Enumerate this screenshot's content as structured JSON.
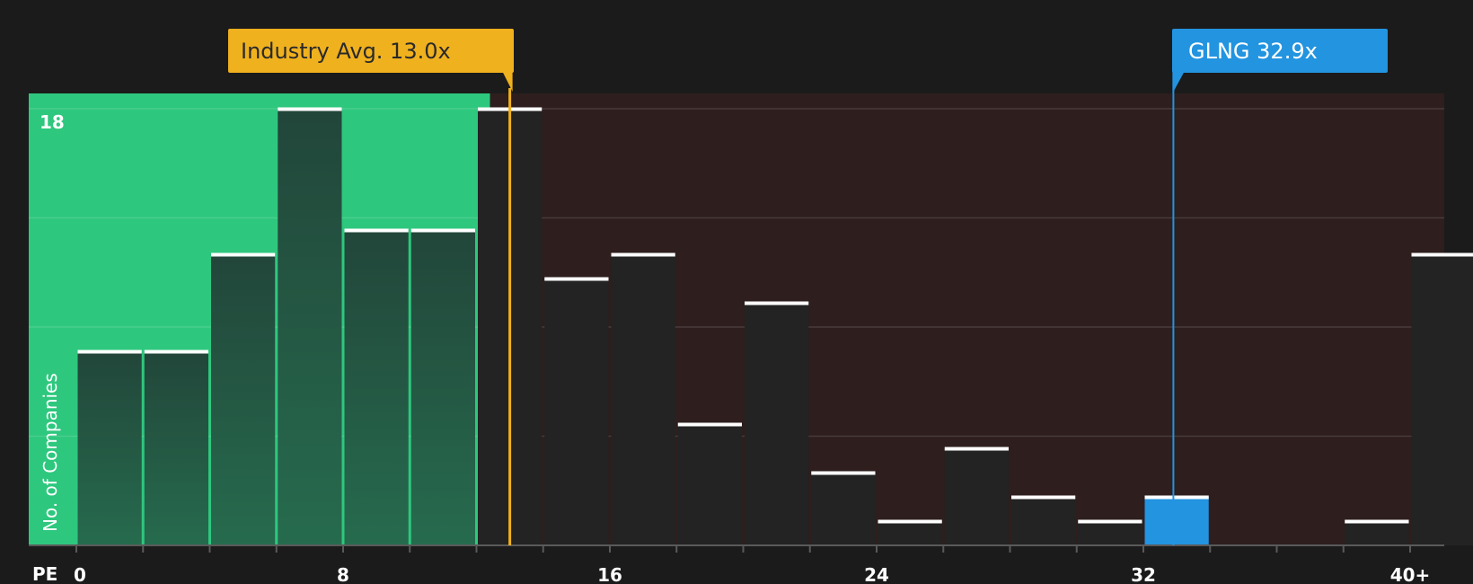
{
  "chart_data": {
    "type": "bar",
    "title": "",
    "xlabel": "PE",
    "ylabel": "No. of Companies",
    "x_ticks": [
      "0",
      "8",
      "16",
      "24",
      "32",
      "40+"
    ],
    "y_tick_labeled": "18",
    "ylim": [
      0,
      18
    ],
    "bin_width": 2,
    "bins_start": [
      0,
      2,
      4,
      6,
      8,
      10,
      12,
      14,
      16,
      18,
      20,
      22,
      24,
      26,
      28,
      30,
      32,
      34,
      36,
      38,
      40
    ],
    "values": [
      8,
      8,
      12,
      18,
      13,
      13,
      18,
      11,
      12,
      5,
      10,
      3,
      1,
      4,
      2,
      1,
      2,
      0,
      0,
      1,
      12
    ],
    "industry_avg": 13.0,
    "industry_avg_label": "Industry Avg. 13.0x",
    "company_value": 32.9,
    "company_label": "GLNG 32.9x",
    "grid": true
  },
  "colors": {
    "background": "#1b1b1b",
    "below_avg_zone": "#2ec77e",
    "above_avg_zone": "#2e1e1e",
    "bar_dark": "#232323",
    "industry_accent": "#f0b11e",
    "company_accent": "#2394e0",
    "bar_cap": "#ffffff"
  }
}
